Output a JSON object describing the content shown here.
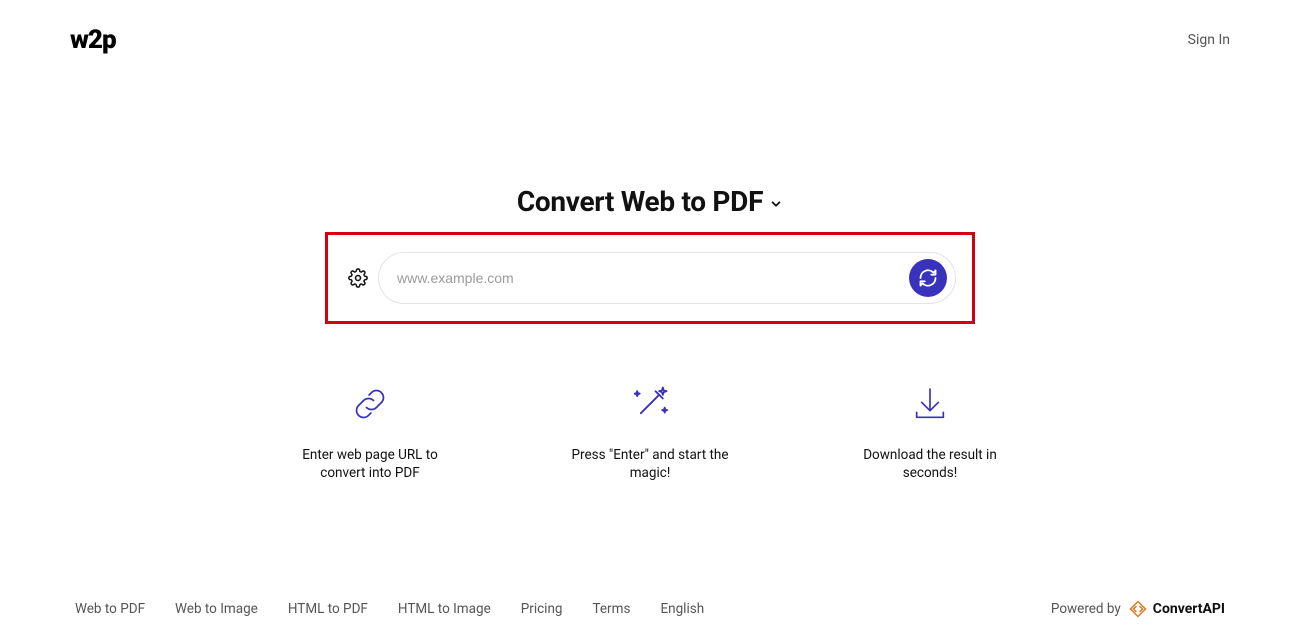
{
  "header": {
    "logo": "w2p",
    "sign_in": "Sign In"
  },
  "main": {
    "title": "Convert Web to PDF",
    "url_placeholder": "www.example.com",
    "url_value": ""
  },
  "steps": [
    {
      "text": "Enter web page URL to convert into PDF"
    },
    {
      "text": "Press \"Enter\" and start the magic!"
    },
    {
      "text": "Download the result in seconds!"
    }
  ],
  "footer": {
    "links": [
      "Web to PDF",
      "Web to Image",
      "HTML to PDF",
      "HTML to Image",
      "Pricing",
      "Terms",
      "English"
    ],
    "powered_by": "Powered by",
    "brand": "ConvertAPI"
  },
  "colors": {
    "accent": "#3832bd",
    "highlight": "#d4000f",
    "brand_orange": "#e07a1f"
  }
}
